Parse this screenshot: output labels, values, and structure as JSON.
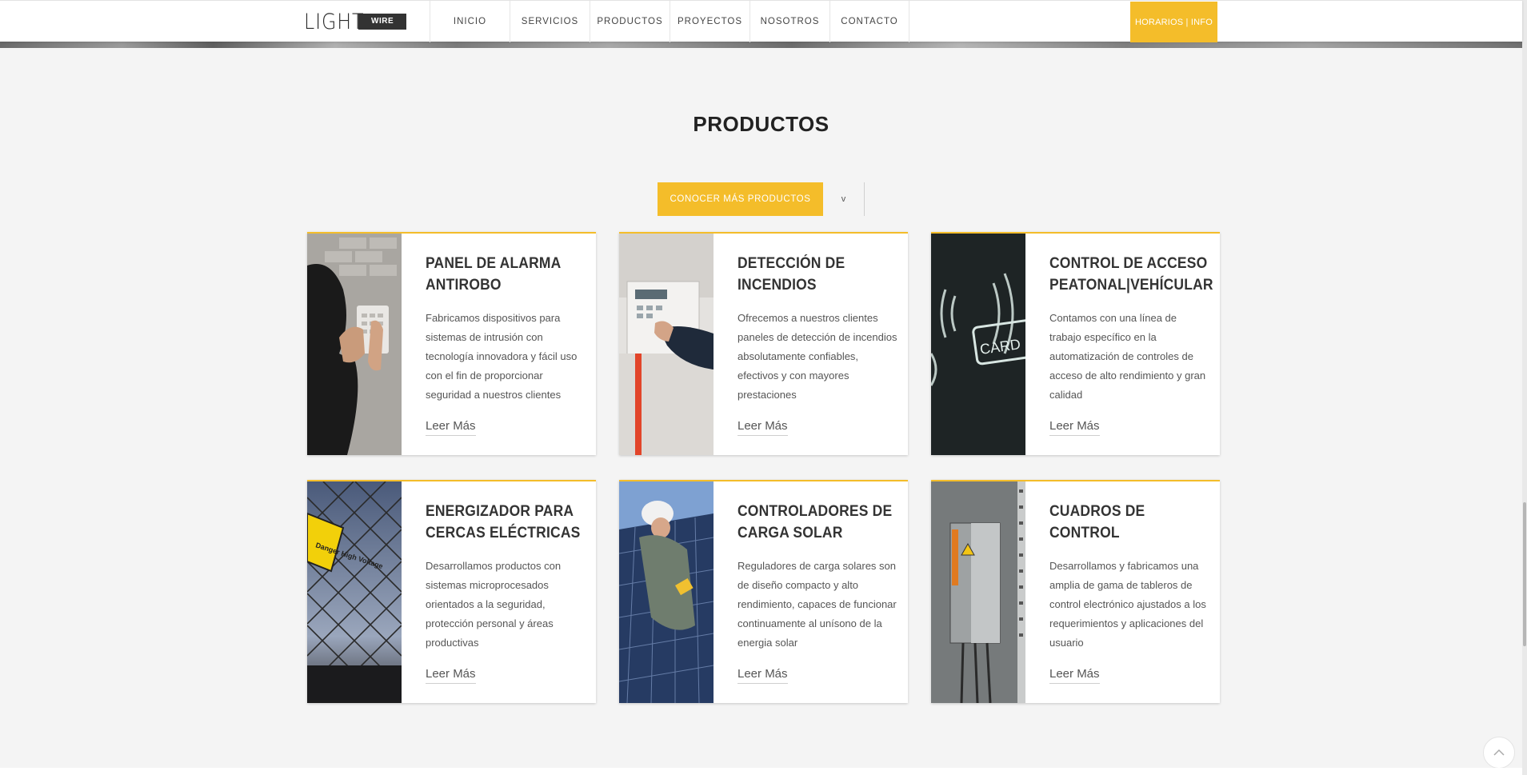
{
  "header": {
    "logo_text": "LIGHT",
    "logo_badge": "WIRE",
    "nav": [
      {
        "label": "INICIO"
      },
      {
        "label": "SERVICIOS"
      },
      {
        "label": "PRODUCTOS"
      },
      {
        "label": "PROYECTOS"
      },
      {
        "label": "NOSOTROS"
      },
      {
        "label": "CONTACTO"
      }
    ],
    "horarios_label": "HORARIOS | INFO"
  },
  "section": {
    "title": "PRODUCTOS",
    "cta_label": "CONOCER MÁS PRODUCTOS",
    "cta_toggle": "v"
  },
  "cards": [
    {
      "title_1": "PANEL DE ALARMA",
      "title_2": "ANTIROBO",
      "text": "Fabricamos dispositivos para sistemas de intrusión con tecnología innovadora y fácil uso con el fin de proporcionar seguridad a nuestros clientes",
      "link": "Leer Más",
      "image_icon": "alarm-keypad-photo"
    },
    {
      "title_1": "DETECCIÓN DE",
      "title_2": "INCENDIOS",
      "text": "Ofrecemos a nuestros clientes paneles de detección de incendios absolutamente confiables, efectivos y con mayores prestaciones",
      "link": "Leer Más",
      "image_icon": "fire-panel-photo"
    },
    {
      "title_1": "CONTROL DE ACCESO",
      "title_2": "PEATONAL|VEHÍCULAR",
      "text": "Contamos con una línea de trabajo específico en la automatización de controles de acceso de alto rendimiento y gran calidad",
      "link": "Leer Más",
      "image_icon": "card-reader-photo",
      "image_text": "CARD"
    },
    {
      "title_1": "ENERGIZADOR PARA",
      "title_2": "CERCAS ELÉCTRICAS",
      "text": "Desarrollamos productos con sistemas microprocesados orientados a la seguridad, protección personal y áreas productivas",
      "link": "Leer Más",
      "image_icon": "electric-fence-photo",
      "image_text": "Danger High Voltage"
    },
    {
      "title_1": "CONTROLADORES DE",
      "title_2": "CARGA SOLAR",
      "text": "Reguladores de carga solares son de diseño compacto y alto rendimiento, capaces de funcionar continuamente al unísono de la energia solar",
      "link": "Leer Más",
      "image_icon": "solar-panel-photo"
    },
    {
      "title_1": "CUADROS DE",
      "title_2": "CONTROL",
      "text": "Desarrollamos y fabricamos una amplia de gama de tableros de control electrónico ajustados a los requerimientos y aplicaciones del usuario",
      "link": "Leer Más",
      "image_icon": "control-cabinet-photo"
    }
  ],
  "back_to_top": "^",
  "colors": {
    "accent": "#f4bd2a",
    "text": "#333333",
    "background": "#f4f4f4"
  }
}
